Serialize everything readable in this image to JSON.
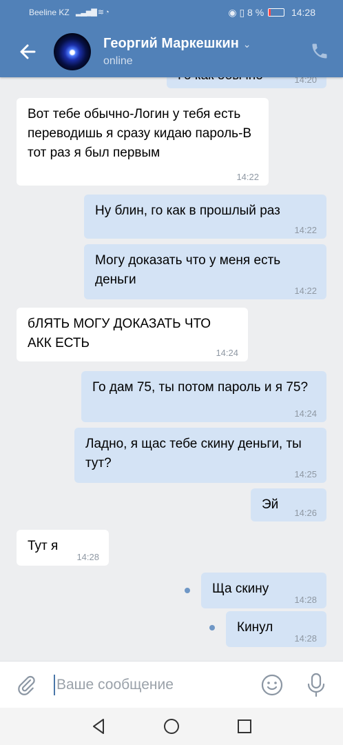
{
  "status_bar": {
    "carrier": "Beeline KZ",
    "battery": "8 %",
    "time": "14:28"
  },
  "header": {
    "back_icon": "arrow-left-icon",
    "contact_name": "Георгий Маркешкин",
    "status": "online",
    "call_icon": "phone-icon"
  },
  "messages": [
    {
      "dir": "out",
      "text": "Го как обычно",
      "time": "14:20",
      "partial": true
    },
    {
      "dir": "in",
      "text": "Вот тебе обычно-Логин у тебя есть переводишь я сразу кидаю пароль-В тот раз я был первым",
      "time": "14:22"
    },
    {
      "dir": "out",
      "text": "Ну блин, го как в прошлый раз",
      "time": "14:22"
    },
    {
      "dir": "out",
      "text": "Могу доказать что у меня есть деньги",
      "time": "14:22"
    },
    {
      "dir": "in",
      "text": "бЛЯТЬ МОГУ ДОКАЗАТЬ ЧТО АКК ЕСТЬ",
      "time": "14:24"
    },
    {
      "dir": "out",
      "text": "Го дам 75, ты потом пароль и я 75?",
      "time": "14:24"
    },
    {
      "dir": "out",
      "text": "Ладно, я щас тебе скину деньги, ты тут?",
      "time": "14:25"
    },
    {
      "dir": "out",
      "text": "Эй",
      "time": "14:26"
    },
    {
      "dir": "in",
      "text": "Тут я",
      "time": "14:28"
    },
    {
      "dir": "out",
      "text": "Ща скину",
      "time": "14:28",
      "unread": true
    },
    {
      "dir": "out",
      "text": "Кинул",
      "time": "14:28",
      "unread": true
    }
  ],
  "composer": {
    "placeholder": "Ваше сообщение",
    "attach_icon": "paperclip-icon",
    "emoji_icon": "smile-icon",
    "mic_icon": "microphone-icon"
  },
  "nav_bar": {
    "back_icon": "triangle-back-icon",
    "home_icon": "circle-home-icon",
    "recent_icon": "square-recent-icon"
  },
  "colors": {
    "header": "#5181b8",
    "incoming_bubble": "#ffffff",
    "outgoing_bubble": "#d4e3f5",
    "background": "#edeef0",
    "unread_dot": "#6f97c6"
  }
}
